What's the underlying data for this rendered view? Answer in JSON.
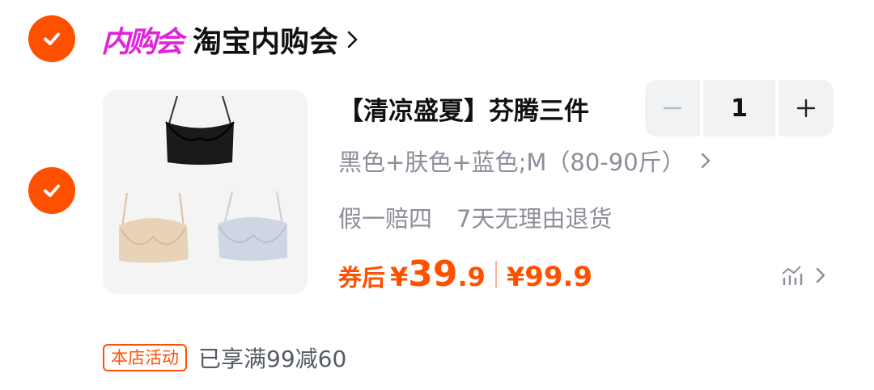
{
  "shop": {
    "logo_text": "内购会",
    "name": "淘宝内购会",
    "selected": true
  },
  "item": {
    "selected": true,
    "title": "【清凉盛夏】芬腾三件",
    "quantity": "1",
    "sku": "黑色+肤色+蓝色;M（80-90斤）",
    "services": [
      "假一赔四",
      "7天无理由退货"
    ],
    "price": {
      "coupon_label": "券后",
      "currency": "¥",
      "int": "39",
      "dec": ".9",
      "original_currency": "¥",
      "original": "99.9"
    }
  },
  "promo": {
    "tag": "本店活动",
    "text": "已享满99减60"
  },
  "colors": {
    "accent": "#ff5000",
    "logo": "#e025d9",
    "muted_text": "#8c8f99"
  }
}
